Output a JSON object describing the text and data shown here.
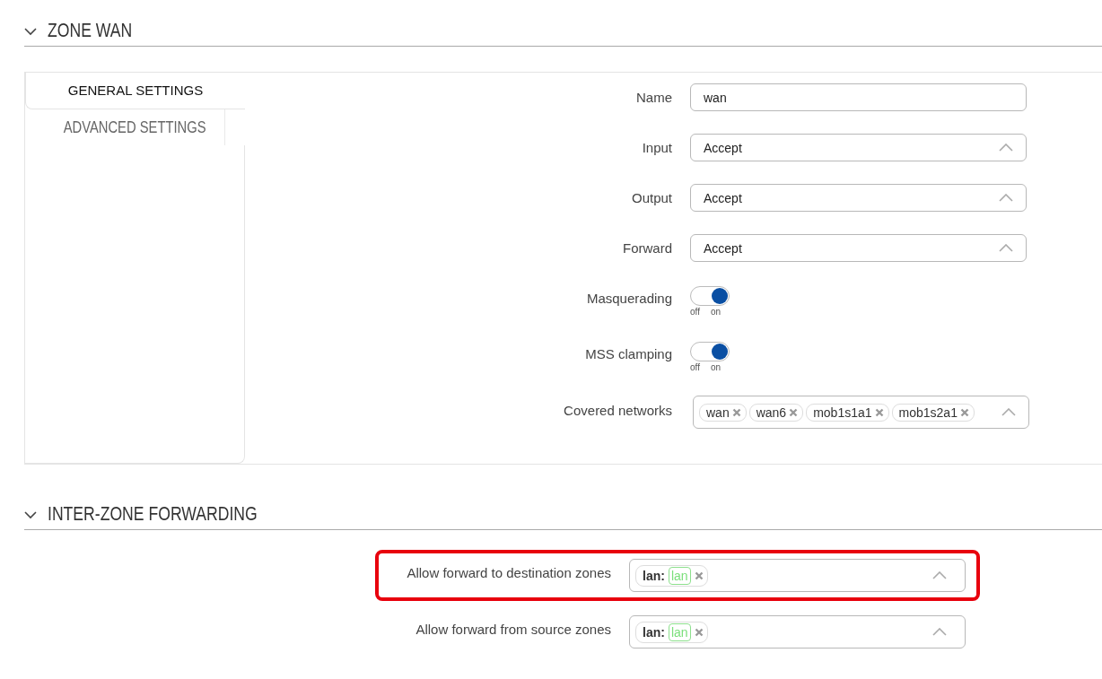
{
  "zone_section": {
    "title": "ZONE WAN",
    "expanded": true
  },
  "tabs": [
    {
      "label": "GENERAL SETTINGS",
      "selected": true
    },
    {
      "label": "ADVANCED SETTINGS",
      "selected": false
    }
  ],
  "fields": [
    {
      "kind": "text",
      "label": "Name",
      "value": "wan"
    },
    {
      "kind": "select",
      "label": "Input",
      "value": "Accept"
    },
    {
      "kind": "select",
      "label": "Output",
      "value": "Accept"
    },
    {
      "kind": "select",
      "label": "Forward",
      "value": "Accept"
    },
    {
      "kind": "toggle",
      "label": "Masquerading",
      "on": true,
      "off_label": "off",
      "on_label": "on"
    },
    {
      "kind": "toggle",
      "label": "MSS clamping",
      "on": true,
      "off_label": "off",
      "on_label": "on"
    },
    {
      "kind": "tags",
      "label": "Covered networks",
      "tags": [
        "wan",
        "wan6",
        "mob1s1a1",
        "mob1s2a1"
      ]
    }
  ],
  "forwarding_section": {
    "title": "INTER-ZONE FORWARDING",
    "expanded": true
  },
  "forwarding": [
    {
      "label": "Allow forward to destination zones",
      "highlighted": true,
      "tags": [
        {
          "zone": "lan:",
          "network": "lan"
        }
      ]
    },
    {
      "label": "Allow forward from source zones",
      "highlighted": false,
      "tags": [
        {
          "zone": "lan:",
          "network": "lan"
        }
      ]
    }
  ]
}
